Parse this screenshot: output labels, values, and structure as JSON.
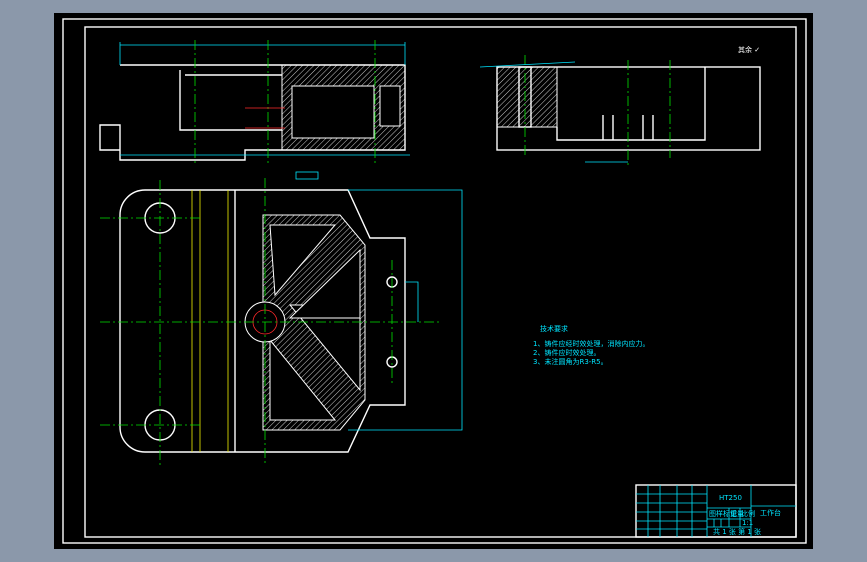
{
  "drawing": {
    "tech_requirements": {
      "title": "技术要求",
      "items": [
        "1、铸件应经时效处理，消除内应力。",
        "2、铸件应时效处理。",
        "3、未注圆角为R3-R5。"
      ]
    },
    "title_block": {
      "material": "HT250",
      "part_name": "工作台",
      "headers": [
        "图样标记",
        "重量",
        "比例"
      ],
      "scale": "1:1",
      "sheet": "共 1 张 第 1 张"
    }
  }
}
